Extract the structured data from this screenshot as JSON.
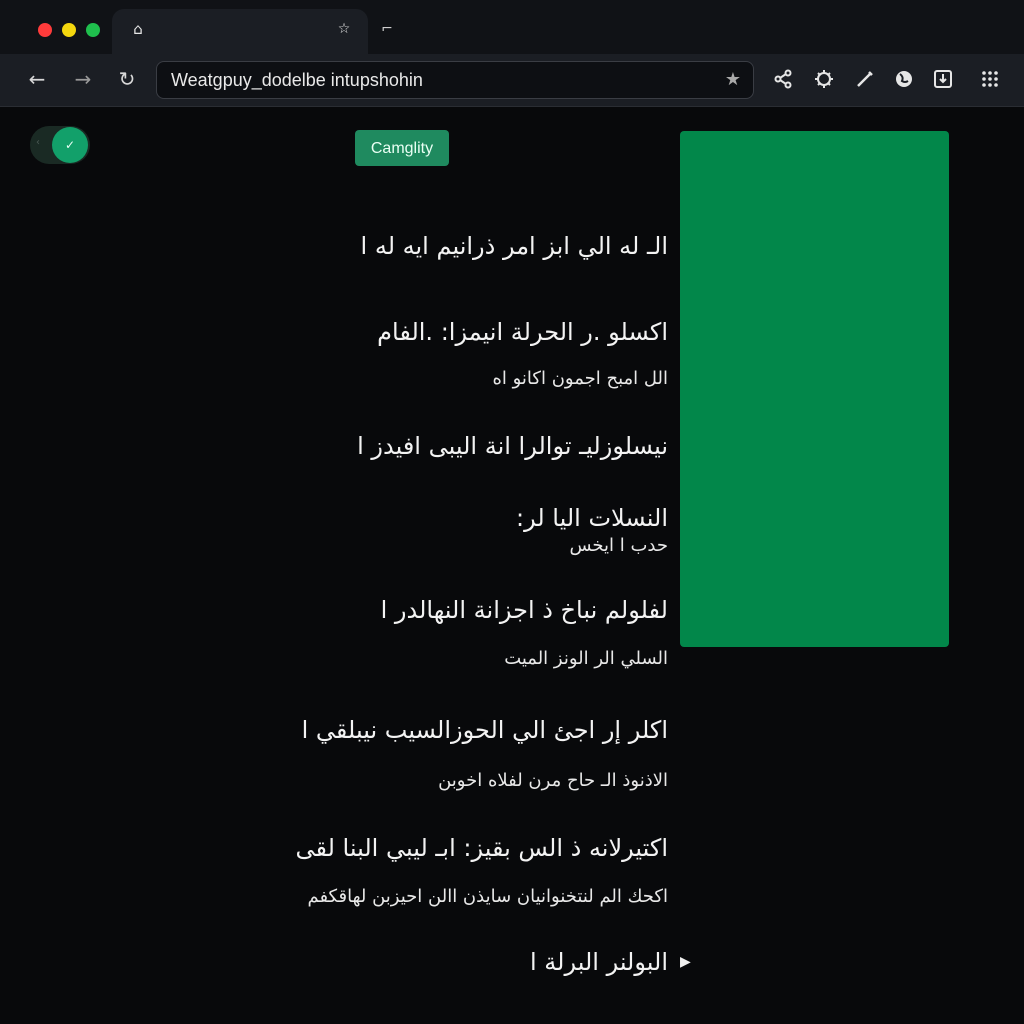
{
  "browser": {
    "tab": {
      "home_icon": "home-icon",
      "star_icon": "star-icon"
    },
    "new_tab_icon": "new-tab-icon",
    "url": "Weatgpuy_dodelbe intupshohin",
    "toolbar_icons": [
      "share-icon",
      "extensions-icon",
      "pen-icon",
      "globe-icon",
      "download-icon",
      "apps-grid-icon"
    ]
  },
  "toggle": {
    "state": "on"
  },
  "category_button": {
    "label": "Camglity"
  },
  "accent_colors": {
    "button": "#1f8a5f",
    "panel": "#02874a"
  },
  "content": {
    "lines": [
      {
        "text": "الـ له الي ابز امر ذرانيم ايه له ا",
        "size": "lg",
        "mark": "ا"
      },
      {
        "text": "اكسلو .ر الحرلة انيمزا: .الفام",
        "size": "lg",
        "mark": ""
      },
      {
        "text": "الل امبح اجمون اكانو اه",
        "size": "sm",
        "mark": ""
      },
      {
        "text": "نيسلوزليـ توالرا انة اليبى افيدز ا",
        "size": "lg",
        "mark": "ا"
      },
      {
        "text": "النسلات اليا لر:",
        "size": "lg",
        "mark": ""
      },
      {
        "text": "حدب ا ايخس",
        "size": "sm",
        "mark": ""
      },
      {
        "text": "لفلولم نباخ ذ اجزانة النهالدر ا",
        "size": "lg",
        "mark": "ا"
      },
      {
        "text": "السلي الر الونز الميت",
        "size": "sm",
        "mark": ""
      },
      {
        "text": "اكلر إر اجئ الي الحوزالسيب نيبلقي ا",
        "size": "lg",
        "mark": "ا"
      },
      {
        "text": "الاذنوذ الـ حاح مرن لفلاه اخوبن",
        "size": "sm",
        "mark": ""
      },
      {
        "text": "اكتيرلانه ذ الس بقيز: ابـ ليبي البنا لقى",
        "size": "lg",
        "mark": ""
      },
      {
        "text": "اكحك الم لنتخنوانيان سايذن االن احيزبن لهاقكفم",
        "size": "sm",
        "mark": ""
      },
      {
        "text": "البولنر البرلة ا",
        "size": "lg",
        "mark": "ا"
      }
    ]
  }
}
